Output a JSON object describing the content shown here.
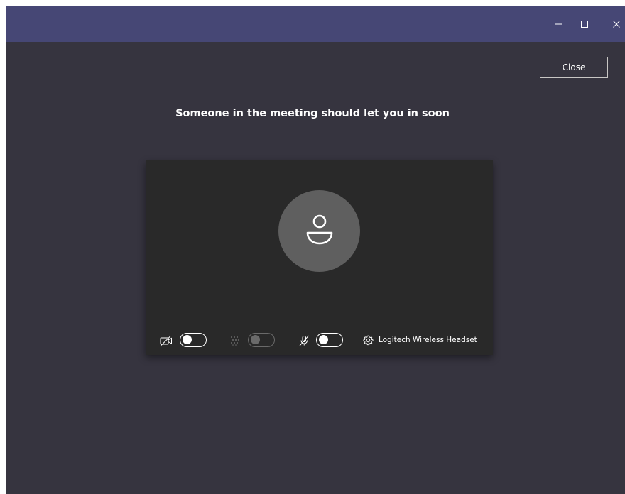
{
  "window": {
    "controls": {
      "minimize_icon": "minimize-icon",
      "maximize_icon": "maximize-icon",
      "close_icon": "close-icon"
    },
    "colors": {
      "titlebar": "#464775",
      "background": "#36343f",
      "preview": "#292929",
      "avatar": "#5f5f5f"
    }
  },
  "header": {
    "close_label": "Close"
  },
  "main": {
    "heading": "Someone in the meeting should let you in soon"
  },
  "preview": {
    "avatar_icon": "person-icon",
    "controls": {
      "camera": {
        "icon": "camera-off-icon",
        "on": false
      },
      "blur": {
        "icon": "background-blur-icon",
        "on": false,
        "disabled": true
      },
      "mic": {
        "icon": "mic-off-icon",
        "on": false
      },
      "device": {
        "icon": "gear-icon",
        "label": "Logitech Wireless Headset"
      }
    }
  }
}
